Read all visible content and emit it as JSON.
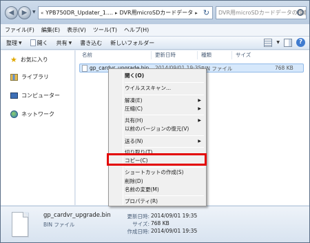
{
  "address": {
    "crumbs": [
      "YPB750DR_Updater_1....",
      "DVR用microSDカードデータ"
    ],
    "search_placeholder": "DVR用microSDカードデータの検索"
  },
  "menubar": [
    "ファイル(F)",
    "編集(E)",
    "表示(V)",
    "ツール(T)",
    "ヘルプ(H)"
  ],
  "toolbar": {
    "organize": "整理",
    "open": "開く",
    "share": "共有",
    "burn": "書き込む",
    "new_folder": "新しいフォルダー"
  },
  "nav": {
    "favorites": "お気に入り",
    "libraries": "ライブラリ",
    "computer": "コンピューター",
    "network": "ネットワーク"
  },
  "columns": {
    "name": "名前",
    "date": "更新日時",
    "type": "種類",
    "size": "サイズ"
  },
  "file": {
    "name": "gp_cardvr_upgrade.bin",
    "date": "2014/09/01 19:35",
    "type": "BIN ファイル",
    "size": "768 KB"
  },
  "context_menu": [
    {
      "label": "開く(O)",
      "bold": true
    },
    {
      "label": "ウイルススキャン..."
    },
    {
      "label": "解凍(E)",
      "submenu": true
    },
    {
      "label": "圧縮(C)",
      "submenu": true
    },
    {
      "label": "共有(H)",
      "submenu": true
    },
    {
      "label": "以前のバージョンの復元(V)"
    },
    {
      "label": "送る(N)",
      "submenu": true
    },
    {
      "label": "切り取り(T)"
    },
    {
      "label": "コピー(C)",
      "highlighted": true
    },
    {
      "label": "ショートカットの作成(S)"
    },
    {
      "label": "削除(D)"
    },
    {
      "label": "名前の変更(M)"
    },
    {
      "label": "プロパティ(R)"
    }
  ],
  "details": {
    "name": "gp_cardvr_upgrade.bin",
    "type": "BIN ファイル",
    "modified_label": "更新日時:",
    "modified": "2014/09/01 19:35",
    "size_label": "サイズ:",
    "size": "768 KB",
    "created_label": "作成日時:",
    "created": "2014/09/01 19:35"
  },
  "colors": {
    "highlight_border": "#e30000",
    "selection_bg": "#d6e8fb"
  }
}
